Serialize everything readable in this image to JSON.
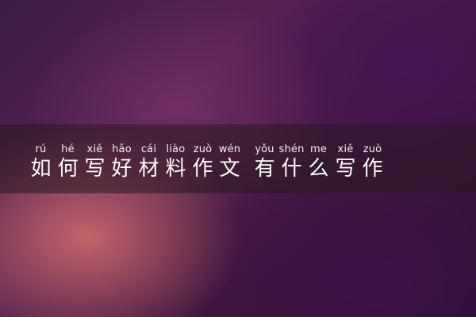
{
  "title": {
    "chars": [
      {
        "pinyin": "rú",
        "hanzi": "如"
      },
      {
        "pinyin": "hé",
        "hanzi": "何"
      },
      {
        "pinyin": "xiě",
        "hanzi": "写"
      },
      {
        "pinyin": "hǎo",
        "hanzi": "好"
      },
      {
        "pinyin": "cái",
        "hanzi": "材"
      },
      {
        "pinyin": "liào",
        "hanzi": "料"
      },
      {
        "pinyin": "zuò",
        "hanzi": "作"
      },
      {
        "pinyin": "wén",
        "hanzi": "文"
      },
      {
        "pinyin": "yǒu",
        "hanzi": "有"
      },
      {
        "pinyin": "shén",
        "hanzi": "什"
      },
      {
        "pinyin": "me",
        "hanzi": "么"
      },
      {
        "pinyin": "xiě",
        "hanzi": "写"
      },
      {
        "pinyin": "zuò",
        "hanzi": "作"
      }
    ]
  }
}
